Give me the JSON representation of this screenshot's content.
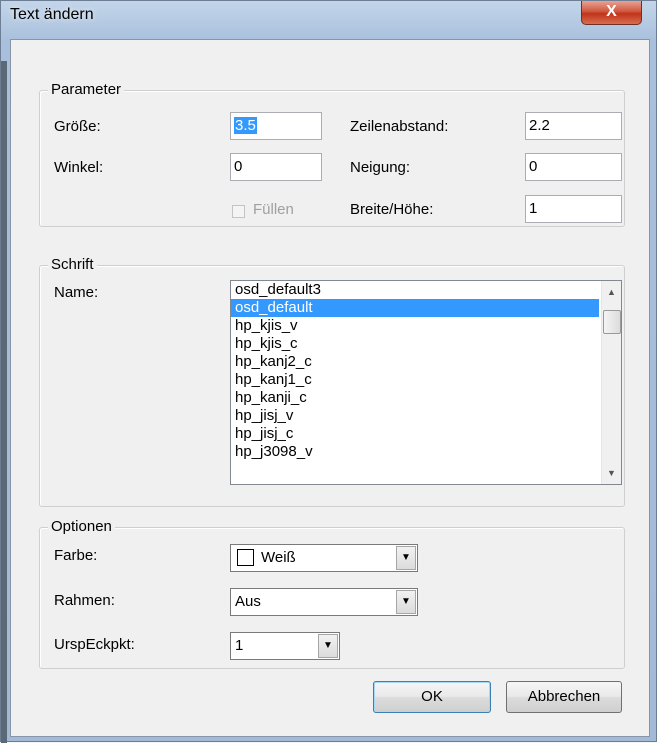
{
  "window": {
    "title": "Text ändern",
    "close_glyph": "X"
  },
  "parameter": {
    "group_label": "Parameter",
    "size_label": "Größe:",
    "size_value": "3.5",
    "line_spacing_label": "Zeilenabstand:",
    "line_spacing_value": "2.2",
    "angle_label": "Winkel:",
    "angle_value": "0",
    "slant_label": "Neigung:",
    "slant_value": "0",
    "fill_label": "Füllen",
    "fill_checked": false,
    "width_height_label": "Breite/Höhe:",
    "width_height_value": "1"
  },
  "font": {
    "group_label": "Schrift",
    "name_label": "Name:",
    "items": [
      "osd_default3",
      "osd_default",
      "hp_kjis_v",
      "hp_kjis_c",
      "hp_kanj2_c",
      "hp_kanj1_c",
      "hp_kanji_c",
      "hp_jisj_v",
      "hp_jisj_c",
      "hp_j3098_v"
    ],
    "selected_index": 1
  },
  "options": {
    "group_label": "Optionen",
    "color_label": "Farbe:",
    "color_value": "Weiß",
    "color_swatch": "#ffffff",
    "frame_label": "Rahmen:",
    "frame_value": "Aus",
    "origin_label": "UrspEckpkt:",
    "origin_value": "1"
  },
  "buttons": {
    "ok": "OK",
    "cancel": "Abbrechen"
  },
  "icons": {
    "dropdown": "▼",
    "scroll_up": "▲",
    "scroll_down": "▼"
  },
  "colors": {
    "selection": "#3399ff",
    "close_button": "#c8432a"
  }
}
